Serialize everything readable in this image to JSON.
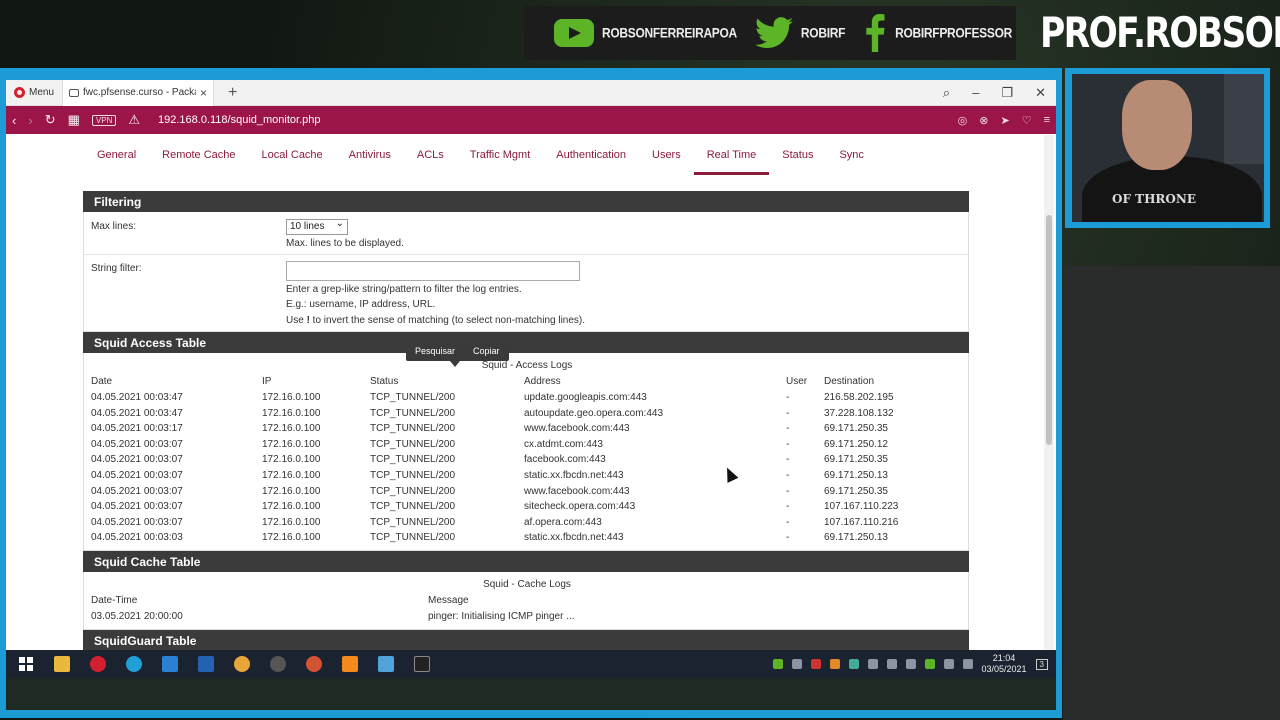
{
  "overlay": {
    "social": [
      {
        "icon": "youtube-icon",
        "label": "ROBSONFERREIRAPOA"
      },
      {
        "icon": "twitter-icon",
        "label": "ROBIRF"
      },
      {
        "icon": "facebook-icon",
        "label": "ROBIRFPROFESSOR"
      }
    ],
    "brand": "PROF.ROBSON",
    "webcam_shirt_text": "OF THRONE"
  },
  "browser": {
    "menu_label": "Menu",
    "tab_title": "fwc.pfsense.curso - Packag",
    "url": "192.168.0.118/squid_monitor.php",
    "vpn_label": "VPN"
  },
  "nav_tabs": [
    {
      "label": "General"
    },
    {
      "label": "Remote Cache"
    },
    {
      "label": "Local Cache"
    },
    {
      "label": "Antivirus"
    },
    {
      "label": "ACLs"
    },
    {
      "label": "Traffic Mgmt"
    },
    {
      "label": "Authentication"
    },
    {
      "label": "Users"
    },
    {
      "label": "Real Time",
      "active": true
    },
    {
      "label": "Status"
    },
    {
      "label": "Sync"
    }
  ],
  "filtering": {
    "title": "Filtering",
    "max_lines_label": "Max lines:",
    "max_lines_value": "10 lines",
    "max_lines_help": "Max. lines to be displayed.",
    "string_filter_label": "String filter:",
    "string_filter_value": "",
    "string_filter_help1": "Enter a grep-like string/pattern to filter the log entries.",
    "string_filter_help2": "E.g.: username, IP address, URL.",
    "string_filter_help3_pre": "Use ",
    "string_filter_help3_bold": "!",
    "string_filter_help3_post": " to invert the sense of matching (to select non-matching lines)."
  },
  "context_menu": {
    "search": "Pesquisar",
    "copy": "Copiar"
  },
  "access_table": {
    "title": "Squid Access Table",
    "caption": "Squid - Access Logs",
    "headers": [
      "Date",
      "IP",
      "Status",
      "Address",
      "User",
      "Destination"
    ],
    "rows": [
      [
        "04.05.2021 00:03:47",
        "172.16.0.100",
        "TCP_TUNNEL/200",
        "update.googleapis.com:443",
        "-",
        "216.58.202.195"
      ],
      [
        "04.05.2021 00:03:47",
        "172.16.0.100",
        "TCP_TUNNEL/200",
        "autoupdate.geo.opera.com:443",
        "-",
        "37.228.108.132"
      ],
      [
        "04.05.2021 00:03:17",
        "172.16.0.100",
        "TCP_TUNNEL/200",
        "www.facebook.com:443",
        "-",
        "69.171.250.35"
      ],
      [
        "04.05.2021 00:03:07",
        "172.16.0.100",
        "TCP_TUNNEL/200",
        "cx.atdmt.com:443",
        "-",
        "69.171.250.12"
      ],
      [
        "04.05.2021 00:03:07",
        "172.16.0.100",
        "TCP_TUNNEL/200",
        "facebook.com:443",
        "-",
        "69.171.250.35"
      ],
      [
        "04.05.2021 00:03:07",
        "172.16.0.100",
        "TCP_TUNNEL/200",
        "static.xx.fbcdn.net:443",
        "-",
        "69.171.250.13"
      ],
      [
        "04.05.2021 00:03:07",
        "172.16.0.100",
        "TCP_TUNNEL/200",
        "www.facebook.com:443",
        "-",
        "69.171.250.35"
      ],
      [
        "04.05.2021 00:03:07",
        "172.16.0.100",
        "TCP_TUNNEL/200",
        "sitecheck.opera.com:443",
        "-",
        "107.167.110.223"
      ],
      [
        "04.05.2021 00:03:07",
        "172.16.0.100",
        "TCP_TUNNEL/200",
        "af.opera.com:443",
        "-",
        "107.167.110.216"
      ],
      [
        "04.05.2021 00:03:03",
        "172.16.0.100",
        "TCP_TUNNEL/200",
        "static.xx.fbcdn.net:443",
        "-",
        "69.171.250.13"
      ]
    ]
  },
  "cache_table": {
    "title": "Squid Cache Table",
    "caption": "Squid - Cache Logs",
    "headers": [
      "Date-Time",
      "Message"
    ],
    "rows": [
      [
        "03.05.2021 20:00:00",
        "pinger: Initialising ICMP pinger ..."
      ]
    ]
  },
  "squidguard_table": {
    "title": "SquidGuard Table"
  },
  "taskbar": {
    "time": "21:04",
    "date": "03/05/2021",
    "notification_count": "3",
    "colors": {
      "accent": "#9c1548",
      "frame": "#1d9bd6",
      "youtube": "#5db427"
    }
  }
}
